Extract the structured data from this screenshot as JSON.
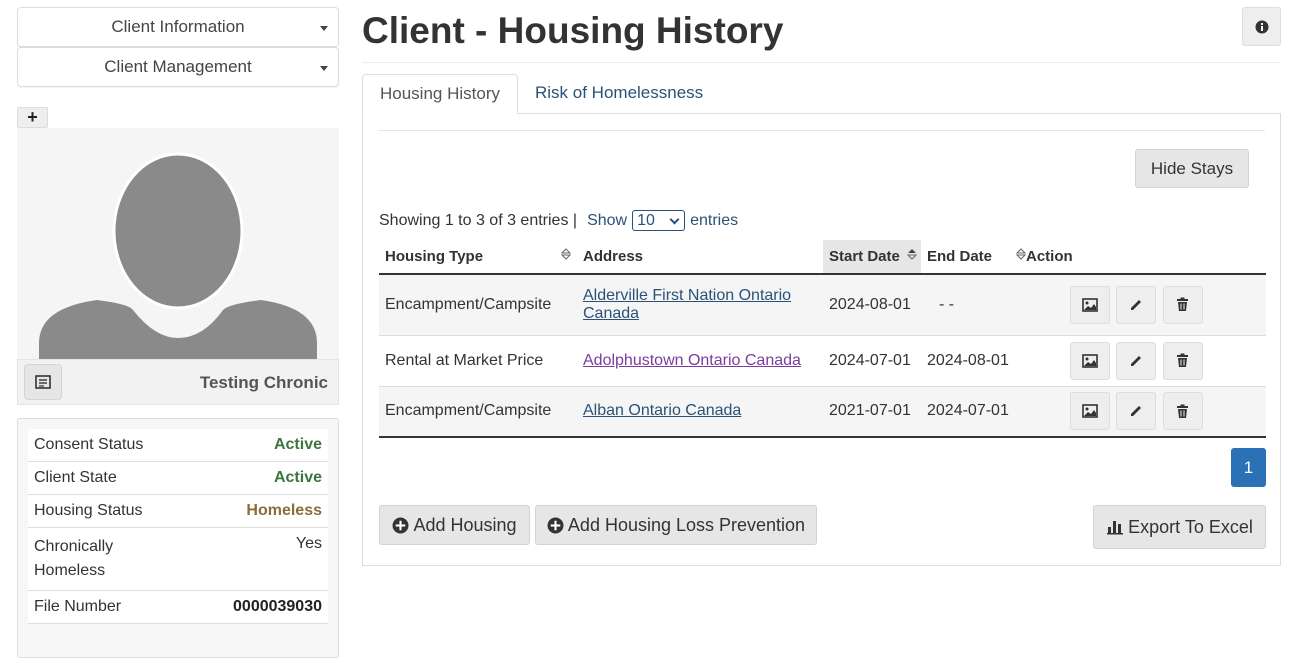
{
  "sidebar": {
    "client_info_label": "Client Information",
    "client_mgmt_label": "Client Management",
    "client_name": "Testing Chronic",
    "info_rows": [
      {
        "label": "Consent Status",
        "value": "Active"
      },
      {
        "label": "Client State",
        "value": "Active"
      },
      {
        "label": "Housing Status",
        "value": "Homeless"
      },
      {
        "label": "Chronically Homeless",
        "value": "Yes"
      },
      {
        "label": "File Number",
        "value": "0000039030"
      }
    ]
  },
  "header": {
    "title": "Client - Housing History"
  },
  "tabs": [
    {
      "label": "Housing History",
      "active": true
    },
    {
      "label": "Risk of Homelessness",
      "active": false
    }
  ],
  "toolbar": {
    "hide_stays_label": "Hide Stays"
  },
  "listing": {
    "showing_text": "Showing 1 to 3 of 3 entries |",
    "show_label": "Show",
    "page_size": "10",
    "entries_label": "entries"
  },
  "table": {
    "columns": [
      "Housing Type",
      "Address",
      "Start Date",
      "End Date",
      "Action"
    ],
    "rows": [
      {
        "type": "Encampment/Campsite",
        "address": "Alderville First Nation Ontario Canada",
        "start": "2024-08-01",
        "end": "- -"
      },
      {
        "type": "Rental at Market Price",
        "address": "Adolphustown Ontario Canada",
        "start": "2024-07-01",
        "end": "2024-08-01"
      },
      {
        "type": "Encampment/Campsite",
        "address": "Alban Ontario Canada",
        "start": "2021-07-01",
        "end": "2024-07-01"
      }
    ]
  },
  "pagination": {
    "current": "1"
  },
  "actions": {
    "add_housing_label": "Add Housing",
    "add_prevention_label": "Add Housing Loss Prevention",
    "export_label": "Export To Excel"
  },
  "colors": {
    "accent": "#2a72b5",
    "link": "#2a5279",
    "active_green": "#3c763d",
    "homeless_brown": "#8a6d3b"
  }
}
